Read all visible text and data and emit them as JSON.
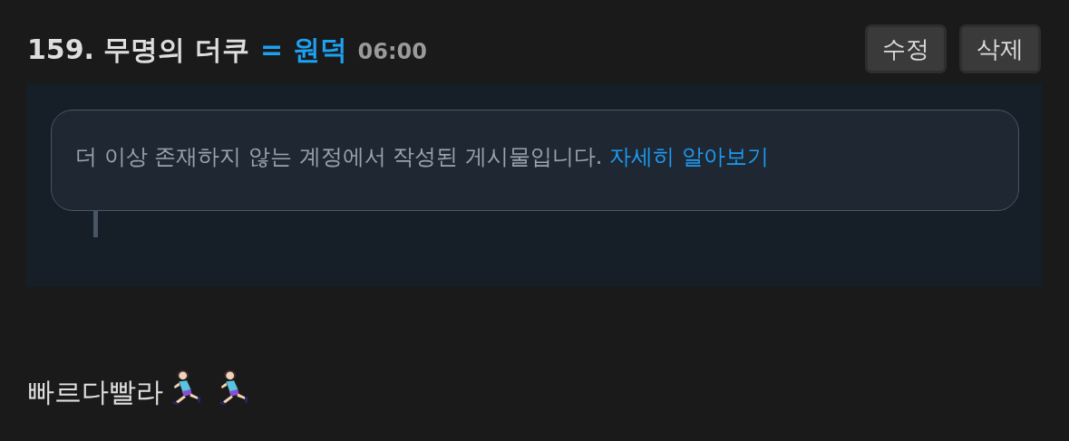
{
  "post": {
    "number": "159.",
    "title": "무명의 더쿠",
    "tag": "= 원덕",
    "time": "06:00"
  },
  "buttons": [
    "수정",
    "삭제"
  ],
  "embed": {
    "notice": "더 이상 존재하지 않는 계정에서 작성된 게시물입니다.",
    "link": "자세히 알아보기"
  },
  "body": {
    "text": "빠르다빨라",
    "icons": [
      {
        "kind": "runner"
      },
      {
        "kind": "runner"
      }
    ]
  }
}
